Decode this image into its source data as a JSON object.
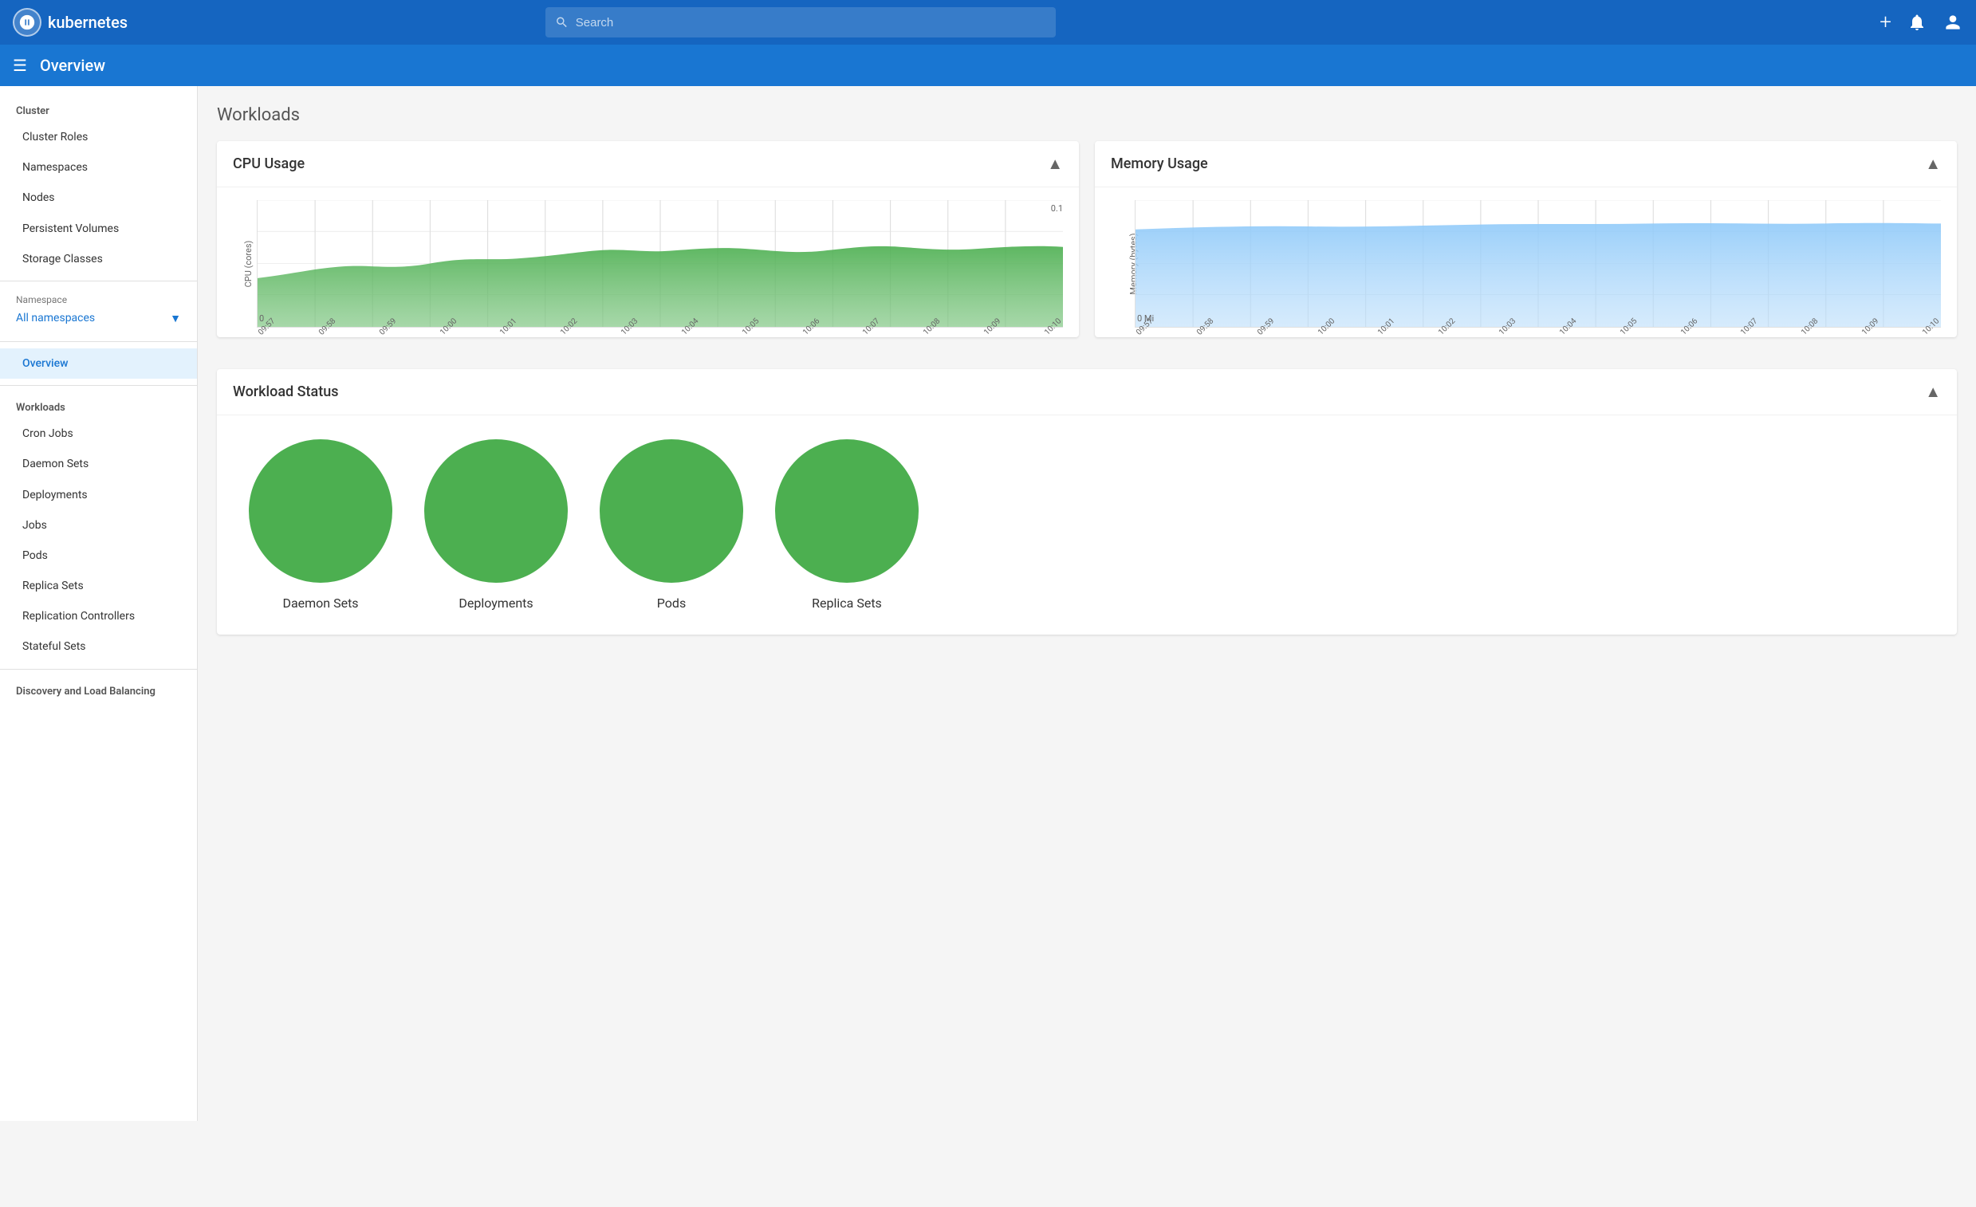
{
  "topNav": {
    "logoText": "kubernetes",
    "searchPlaceholder": "Search"
  },
  "subHeader": {
    "title": "Overview"
  },
  "sidebar": {
    "clusterSection": "Cluster",
    "clusterItems": [
      "Cluster Roles",
      "Namespaces",
      "Nodes",
      "Persistent Volumes",
      "Storage Classes"
    ],
    "namespaceLabel": "Namespace",
    "namespaceValue": "All namespaces",
    "navItems": [
      {
        "label": "Overview",
        "active": true
      }
    ],
    "workloadsSection": "Workloads",
    "workloadItems": [
      "Cron Jobs",
      "Daemon Sets",
      "Deployments",
      "Jobs",
      "Pods",
      "Replica Sets",
      "Replication Controllers",
      "Stateful Sets"
    ],
    "discoverySection": "Discovery and Load Balancing"
  },
  "mainContent": {
    "pageTitle": "Workloads",
    "cpuChart": {
      "title": "CPU Usage",
      "yLabel": "CPU (cores)",
      "yTop": "0.1",
      "yBottom": "0",
      "xLabels": [
        "09:57",
        "09:58",
        "09:59",
        "10:00",
        "10:01",
        "10:02",
        "10:03",
        "10:04",
        "10:05",
        "10:06",
        "10:07",
        "10:08",
        "10:09",
        "10:10"
      ]
    },
    "memoryChart": {
      "title": "Memory Usage",
      "yLabel": "Memory (bytes)",
      "yBottom": "0 Mi",
      "xLabels": [
        "09:57",
        "09:58",
        "09:59",
        "10:00",
        "10:01",
        "10:02",
        "10:03",
        "10:04",
        "10:05",
        "10:06",
        "10:07",
        "10:08",
        "10:09",
        "10:10"
      ]
    },
    "workloadStatus": {
      "title": "Workload Status",
      "items": [
        {
          "label": "Daemon Sets"
        },
        {
          "label": "Deployments"
        },
        {
          "label": "Pods"
        },
        {
          "label": "Replica Sets"
        }
      ]
    }
  }
}
